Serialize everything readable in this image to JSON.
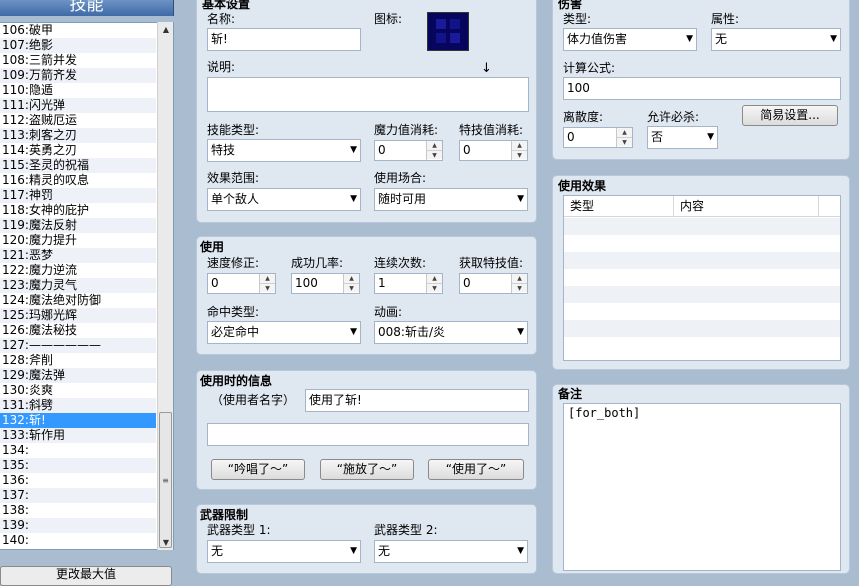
{
  "list": {
    "header": "技能",
    "items": [
      "106:破甲",
      "107:绝影",
      "108:三箭并发",
      "109:万箭齐发",
      "110:隐遁",
      "111:闪光弹",
      "112:盗贼厄运",
      "113:刺客之刃",
      "114:英勇之刃",
      "115:圣灵的祝福",
      "116:精灵的叹息",
      "117:神罚",
      "118:女神的庇护",
      "119:魔法反射",
      "120:魔力提升",
      "121:恶梦",
      "122:魔力逆流",
      "123:魔力灵气",
      "124:魔法绝对防御",
      "125:玛娜光辉",
      "126:魔法秘技",
      "127:——————",
      "128:斧削",
      "129:魔法弹",
      "130:炎爽",
      "131:斜劈",
      "132:斩!",
      "133:斩作用",
      "134:",
      "135:",
      "136:",
      "137:",
      "138:",
      "139:",
      "140:"
    ],
    "selected_index": 26,
    "change_max_button": "更改最大值"
  },
  "basic": {
    "title": "基本设置",
    "name_label": "名称:",
    "name_value": "斩!",
    "icon_label": "图标:",
    "desc_label": "说明:",
    "desc_cursor": "↓",
    "skill_type_label": "技能类型:",
    "skill_type_value": "特技",
    "mp_cost_label": "魔力值消耗:",
    "mp_cost_value": "0",
    "tp_cost_label": "特技值消耗:",
    "tp_cost_value": "0",
    "scope_label": "效果范围:",
    "scope_value": "单个敌人",
    "occasion_label": "使用场合:",
    "occasion_value": "随时可用"
  },
  "invocation": {
    "title": "使用",
    "speed_label": "速度修正:",
    "speed_value": "0",
    "success_label": "成功几率:",
    "success_value": "100",
    "repeat_label": "连续次数:",
    "repeat_value": "1",
    "tp_gain_label": "获取特技值:",
    "tp_gain_value": "0",
    "hit_type_label": "命中类型:",
    "hit_type_value": "必定命中",
    "animation_label": "动画:",
    "animation_value": "008:斩击/炎"
  },
  "message": {
    "title": "使用时的信息",
    "user_name_label": "（使用者名字）",
    "line1_value": "使用了斩!",
    "line2_value": "",
    "btn_sing": "“吟唱了～”",
    "btn_cast": "“施放了～”",
    "btn_use": "“使用了～”"
  },
  "weapon": {
    "title": "武器限制",
    "type1_label": "武器类型 1:",
    "type1_value": "无",
    "type2_label": "武器类型 2:",
    "type2_value": "无"
  },
  "damage": {
    "title": "伤害",
    "type_label": "类型:",
    "type_value": "体力值伤害",
    "element_label": "属性:",
    "element_value": "无",
    "formula_label": "计算公式:",
    "formula_value": "100",
    "variance_label": "离散度:",
    "variance_value": "0",
    "critical_label": "允许必杀:",
    "critical_value": "否",
    "quick_setting_button": "简易设置..."
  },
  "effects": {
    "title": "使用效果",
    "col_type": "类型",
    "col_content": "内容"
  },
  "note": {
    "title": "备注",
    "value": "[for_both]"
  }
}
